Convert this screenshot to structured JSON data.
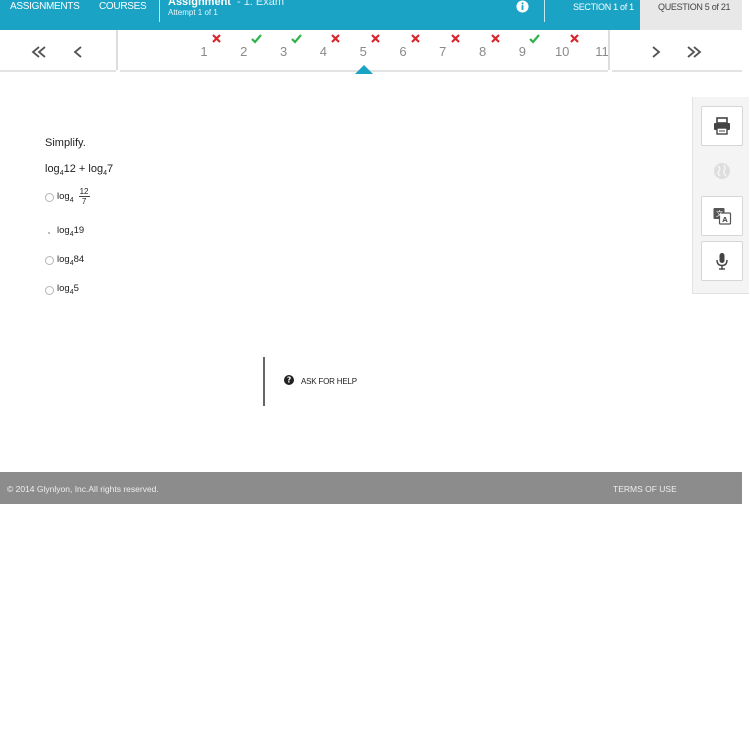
{
  "topbar": {
    "assignments_label": "ASSIGNMENTS",
    "courses_label": "COURSES",
    "assignment_title": "Assignment",
    "assignment_subtitle": "- 1. Exam",
    "attempt_text": "Attempt 1 of 1",
    "info_icon": "info-icon",
    "section_text": "SECTION 1 of 1",
    "question_text": "QUESTION 5 of 21"
  },
  "nav": {
    "first_icon": "double-chevron-left-icon",
    "prev_icon": "chevron-left-icon",
    "next_icon": "chevron-right-icon",
    "last_icon": "double-chevron-right-icon",
    "current": 5,
    "questions": [
      {
        "number": "1",
        "status": "incorrect"
      },
      {
        "number": "2",
        "status": "correct"
      },
      {
        "number": "3",
        "status": "correct"
      },
      {
        "number": "4",
        "status": "incorrect"
      },
      {
        "number": "5",
        "status": "incorrect"
      },
      {
        "number": "6",
        "status": "incorrect"
      },
      {
        "number": "7",
        "status": "incorrect"
      },
      {
        "number": "8",
        "status": "incorrect"
      },
      {
        "number": "9",
        "status": "correct"
      },
      {
        "number": "10",
        "status": "incorrect"
      },
      {
        "number": "11",
        "status": "none"
      }
    ],
    "colors": {
      "correct": "#2db34a",
      "incorrect": "#d9262c",
      "accent": "#1aa3c4"
    }
  },
  "question": {
    "prompt": "Simplify.",
    "expression": {
      "fn": "log",
      "base": "4",
      "a": "12",
      "op": "+",
      "b": "7"
    },
    "choices": [
      {
        "fn": "log",
        "base": "4",
        "numerator": "12",
        "denominator": "7",
        "radio_style": "circle"
      },
      {
        "fn": "log",
        "base": "4",
        "arg": "19",
        "radio_style": "dot"
      },
      {
        "fn": "log",
        "base": "4",
        "arg": "84",
        "radio_style": "circle"
      },
      {
        "fn": "log",
        "base": "4",
        "arg": "5",
        "radio_style": "circle"
      }
    ]
  },
  "tools": [
    {
      "name": "print-icon",
      "enabled": true
    },
    {
      "name": "globe-icon",
      "enabled": false
    },
    {
      "name": "translate-icon",
      "enabled": true
    },
    {
      "name": "microphone-icon",
      "enabled": true
    }
  ],
  "help": {
    "label": "ASK FOR HELP",
    "icon": "question-circle-icon"
  },
  "footer": {
    "copyright": "© 2014 Glynlyon, Inc.All rights reserved.",
    "terms": "TERMS OF USE"
  }
}
